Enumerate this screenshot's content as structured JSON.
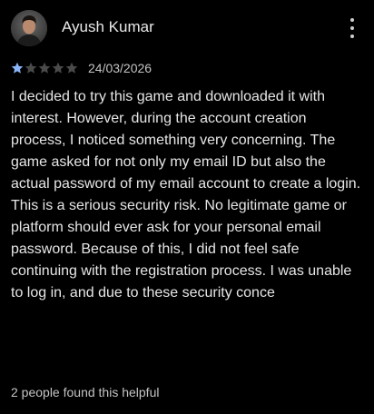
{
  "review": {
    "author_name": "Ayush Kumar",
    "rating": 1,
    "max_rating": 5,
    "date": "24/03/2026",
    "text": "I decided to try this game and downloaded it with interest. However, during the account creation process, I noticed something very concerning. The game asked for not only my email ID but also the actual password of my email account to create a login. This is a serious security risk. No legitimate game or platform should ever ask for your personal email password. Because of this, I did not feel safe continuing with the registration process. I was unable to log in, and due to these security conce",
    "helpful_text": "2 people found this helpful",
    "avatar_icon": "user-avatar",
    "menu_icon": "more-vert-icon"
  },
  "colors": {
    "background": "#000000",
    "star_filled": "#8ab4f8",
    "star_empty": "#4a4a4a",
    "text_primary": "#e6e6e6",
    "text_secondary": "#c4c4c4"
  }
}
